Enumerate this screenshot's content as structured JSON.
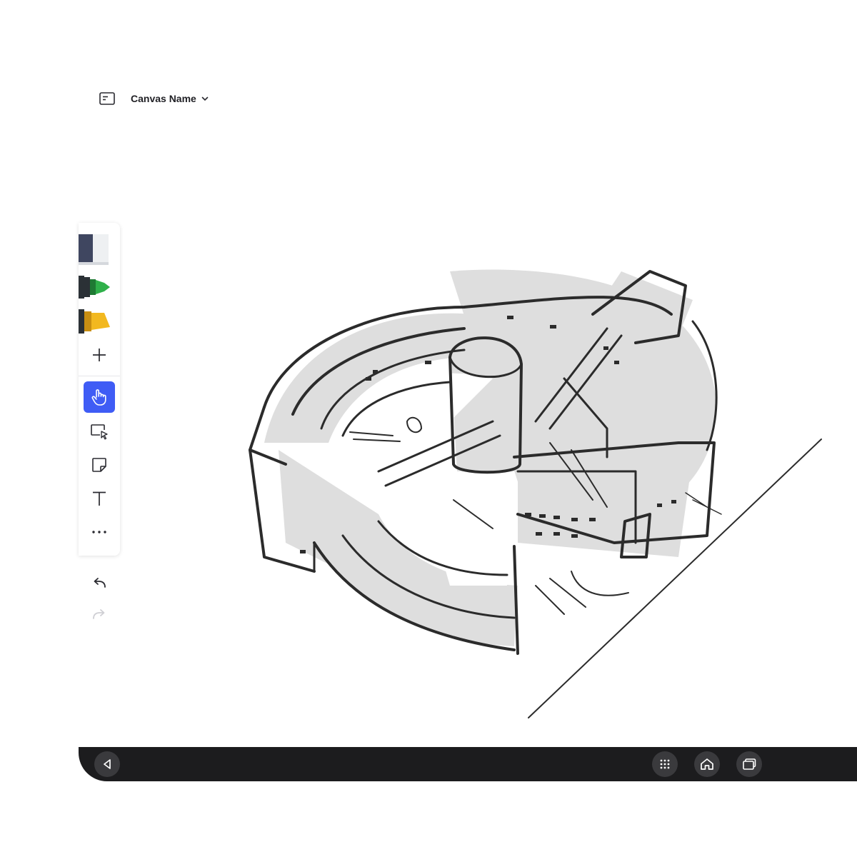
{
  "header": {
    "canvas_name": "Canvas Name",
    "icon": "canvas-card-icon",
    "dropdown_icon": "chevron-down-icon"
  },
  "toolbar": {
    "pens": [
      {
        "name": "eraser",
        "icon": "eraser-icon",
        "color": "#3f4660"
      },
      {
        "name": "green-marker",
        "icon": "marker-icon",
        "color": "#2fb04a"
      },
      {
        "name": "yellow-highlighter",
        "icon": "highlighter-icon",
        "color": "#f2b81f"
      }
    ],
    "tools": [
      {
        "name": "add",
        "icon": "plus-icon"
      },
      {
        "name": "pan",
        "icon": "hand-pointer-icon",
        "active": true
      },
      {
        "name": "select",
        "icon": "select-area-icon"
      },
      {
        "name": "sticky-note",
        "icon": "sticky-note-icon"
      },
      {
        "name": "text",
        "icon": "text-icon"
      },
      {
        "name": "more",
        "icon": "more-horizontal-icon"
      }
    ],
    "accent_color": "#3f5cf5"
  },
  "history": {
    "undo_icon": "undo-icon",
    "redo_icon": "redo-icon"
  },
  "navbar": {
    "back_icon": "back-triangle-icon",
    "apps_icon": "apps-grid-icon",
    "home_icon": "home-icon",
    "recents_icon": "recents-icon",
    "background": "#1c1c1e"
  }
}
